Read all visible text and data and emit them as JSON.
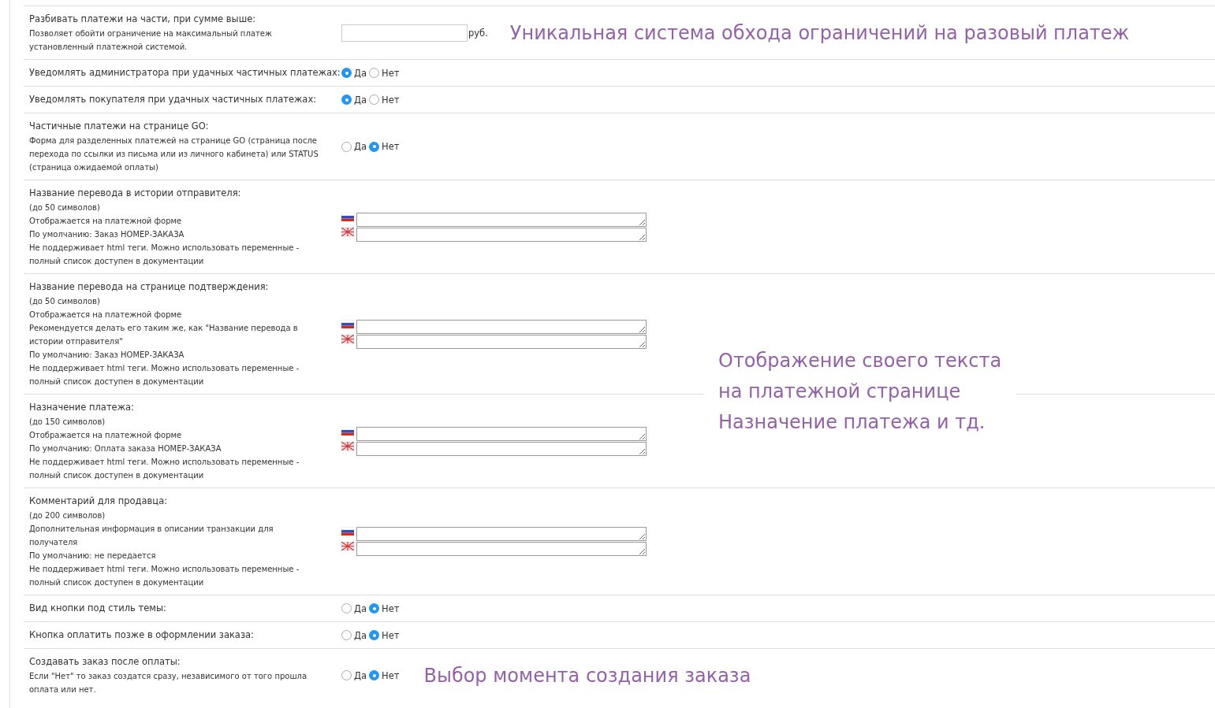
{
  "settings": [
    {
      "kind": "amount",
      "title": "Разбивать платежи на части, при сумме выше:",
      "description": [
        "Позволяет обойти ограничение на максимальный платеж установленный платежной системой."
      ],
      "unit": "руб.",
      "annotation": "Уникальная система обхода ограничений на разовый платеж"
    },
    {
      "kind": "radio",
      "title": "Уведомлять администратора при удачных частичных платежах:",
      "options": [
        {
          "label": "Да",
          "selected": true
        },
        {
          "label": "Нет",
          "selected": false
        }
      ]
    },
    {
      "kind": "radio",
      "title": "Уведомлять покупателя при удачных частичных платежах:",
      "options": [
        {
          "label": "Да",
          "selected": true
        },
        {
          "label": "Нет",
          "selected": false
        }
      ]
    },
    {
      "kind": "radio",
      "title": "Частичные платежи на странице GO:",
      "description": [
        "Форма для разделенных платежей на странице GO (страница после перехода по ссылки из письма или из личного кабинета) или STATUS (страница ожидаемой оплаты)"
      ],
      "options": [
        {
          "label": "Да",
          "selected": false
        },
        {
          "label": "Нет",
          "selected": true
        }
      ]
    },
    {
      "kind": "localized",
      "title": "Название перевода в истории отправителя:",
      "description": [
        "(до 50 символов)",
        "Отображается на платежной форме",
        "По умолчанию: Заказ НОМЕР-ЗАКАЗА",
        "Не поддерживает html теги. Можно использовать переменные - полный список доступен в документации"
      ]
    },
    {
      "kind": "localized",
      "title": "Название перевода на странице подтверждения:",
      "description": [
        "(до 50 символов)",
        "Отображается на платежной форме",
        "Рекомендуется делать его таким же, как \"Название перевода в истории отправителя\"",
        "По умолчанию: Заказ НОМЕР-ЗАКАЗА",
        "Не поддерживает html теги. Можно использовать переменные - полный список доступен в документации"
      ]
    },
    {
      "kind": "localized",
      "title": "Назначение платежа:",
      "description": [
        "(до 150 символов)",
        "Отображается на платежной форме",
        "По умолчанию: Оплата заказа НОМЕР-ЗАКАЗА",
        "Не поддерживает html теги. Можно использовать переменные - полный список доступен в документации"
      ]
    },
    {
      "kind": "localized",
      "title": "Комментарий для продавца:",
      "description": [
        "(до 200 символов)",
        "Дополнительная информация в описании транзакции для получателя",
        "По умолчанию: не передается",
        "Не поддерживает html теги. Можно использовать переменные - полный список доступен в документации"
      ]
    },
    {
      "kind": "radio",
      "title": "Вид кнопки под стиль темы:",
      "options": [
        {
          "label": "Да",
          "selected": false
        },
        {
          "label": "Нет",
          "selected": true
        }
      ]
    },
    {
      "kind": "radio",
      "title": "Кнопка оплатить позже в оформлении заказа:",
      "options": [
        {
          "label": "Да",
          "selected": false
        },
        {
          "label": "Нет",
          "selected": true
        }
      ]
    },
    {
      "kind": "radio",
      "title": "Создавать заказ после оплаты:",
      "description": [
        "Если \"Нет\" то заказ создатся сразу, независимого от того прошла оплата или нет."
      ],
      "options": [
        {
          "label": "Да",
          "selected": false
        },
        {
          "label": "Нет",
          "selected": true
        }
      ],
      "annotation": "Выбор момента создания заказа"
    }
  ],
  "overlay_note": [
    "Отображение своего текста",
    "на платежной странице",
    "Назначение платежа и тд."
  ]
}
